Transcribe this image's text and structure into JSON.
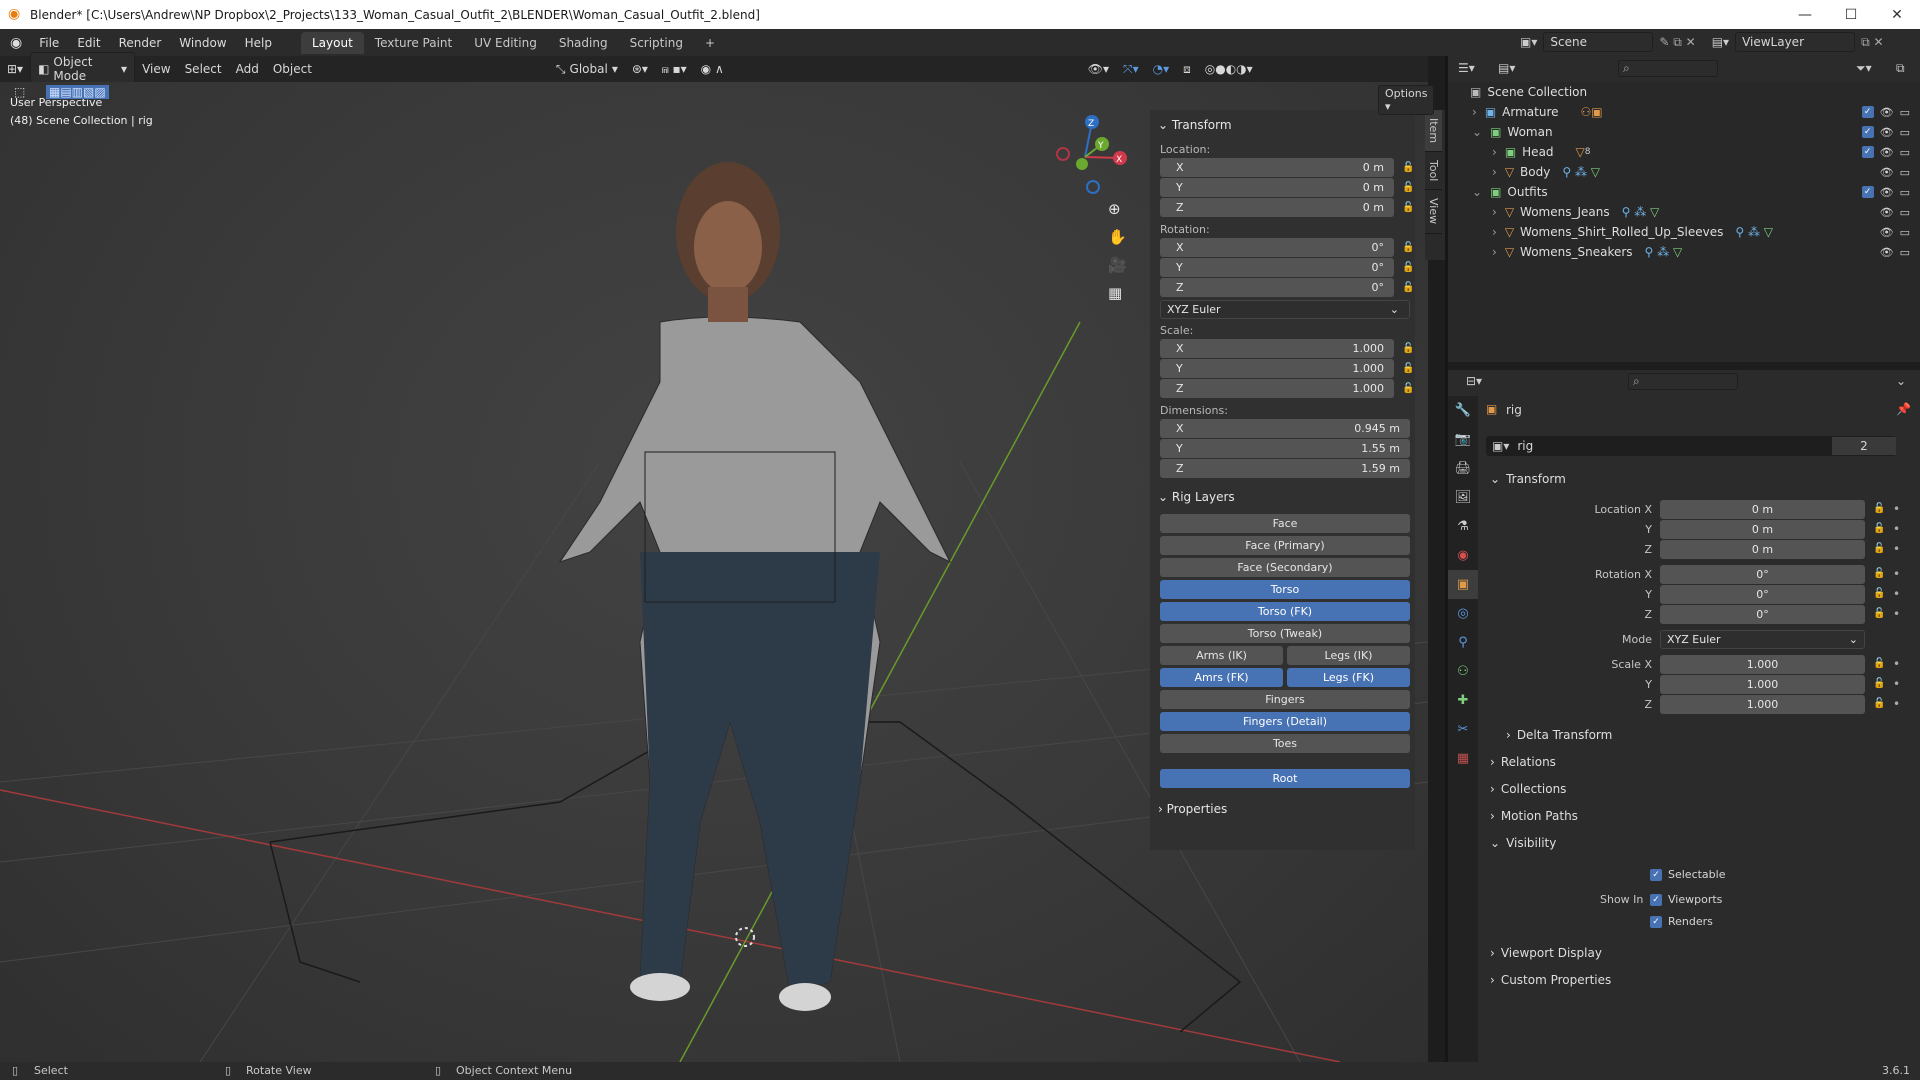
{
  "window": {
    "title": "Blender* [C:\\Users\\Andrew\\NP Dropbox\\2_Projects\\133_Woman_Casual_Outfit_2\\BLENDER\\Woman_Casual_Outfit_2.blend]"
  },
  "menu": {
    "items": [
      "File",
      "Edit",
      "Render",
      "Window",
      "Help"
    ]
  },
  "workspaces": [
    "Layout",
    "Texture Paint",
    "UV Editing",
    "Shading",
    "Scripting"
  ],
  "workspace_add": "+",
  "active_workspace": "Layout",
  "scene": {
    "label": "Scene",
    "viewlayer": "ViewLayer"
  },
  "viewport_header": {
    "mode": "Object Mode",
    "menus": [
      "View",
      "Select",
      "Add",
      "Object"
    ],
    "orientation": "Global",
    "options": "Options"
  },
  "viewport": {
    "perspective": "User Perspective",
    "collection": "(48) Scene Collection | rig"
  },
  "gizmo": {
    "x": "X",
    "y": "Y",
    "z": "Z"
  },
  "npanel": {
    "tabs": [
      "Item",
      "Tool",
      "View"
    ],
    "transform_title": "Transform",
    "location_label": "Location:",
    "location": [
      {
        "axis": "X",
        "value": "0 m"
      },
      {
        "axis": "Y",
        "value": "0 m"
      },
      {
        "axis": "Z",
        "value": "0 m"
      }
    ],
    "rotation_label": "Rotation:",
    "rotation": [
      {
        "axis": "X",
        "value": "0°"
      },
      {
        "axis": "Y",
        "value": "0°"
      },
      {
        "axis": "Z",
        "value": "0°"
      }
    ],
    "rotation_mode": "XYZ Euler",
    "scale_label": "Scale:",
    "scale": [
      {
        "axis": "X",
        "value": "1.000"
      },
      {
        "axis": "Y",
        "value": "1.000"
      },
      {
        "axis": "Z",
        "value": "1.000"
      }
    ],
    "dimensions_label": "Dimensions:",
    "dimensions": [
      {
        "axis": "X",
        "value": "0.945 m"
      },
      {
        "axis": "Y",
        "value": "1.55 m"
      },
      {
        "axis": "Z",
        "value": "1.59 m"
      }
    ],
    "rig_layers_title": "Rig Layers",
    "rig_layers": {
      "face": {
        "label": "Face",
        "on": false
      },
      "face_primary": {
        "label": "Face (Primary)",
        "on": false
      },
      "face_secondary": {
        "label": "Face (Secondary)",
        "on": false
      },
      "torso": {
        "label": "Torso",
        "on": true
      },
      "torso_fk": {
        "label": "Torso (FK)",
        "on": true
      },
      "torso_tweak": {
        "label": "Torso (Tweak)",
        "on": false
      },
      "arms_ik": {
        "label": "Arms (IK)",
        "on": false
      },
      "legs_ik": {
        "label": "Legs (IK)",
        "on": false
      },
      "arms_fk": {
        "label": "Amrs (FK)",
        "on": true
      },
      "legs_fk": {
        "label": "Legs (FK)",
        "on": true
      },
      "fingers": {
        "label": "Fingers",
        "on": false
      },
      "fingers_detail": {
        "label": "Fingers (Detail)",
        "on": true
      },
      "toes": {
        "label": "Toes",
        "on": false
      },
      "root": {
        "label": "Root",
        "on": true
      }
    },
    "properties_title": "Properties"
  },
  "outliner": {
    "root": "Scene Collection",
    "armature": "Armature",
    "woman": "Woman",
    "head": "Head",
    "head_badge": "8",
    "body": "Body",
    "outfits": "Outfits",
    "jeans": "Womens_Jeans",
    "shirt": "Womens_Shirt_Rolled_Up_Sleeves",
    "sneakers": "Womens_Sneakers"
  },
  "properties": {
    "object_name": "rig",
    "data_name": "rig",
    "users": "2",
    "transform_title": "Transform",
    "location_x_label": "Location X",
    "y_label": "Y",
    "z_label": "Z",
    "location": [
      "0 m",
      "0 m",
      "0 m"
    ],
    "rotation_x_label": "Rotation X",
    "rotation": [
      "0°",
      "0°",
      "0°"
    ],
    "mode_label": "Mode",
    "mode_value": "XYZ Euler",
    "scale_x_label": "Scale X",
    "scale": [
      "1.000",
      "1.000",
      "1.000"
    ],
    "delta_transform": "Delta Transform",
    "relations": "Relations",
    "collections": "Collections",
    "motion_paths": "Motion Paths",
    "visibility": "Visibility",
    "selectable": "Selectable",
    "show_in": "Show In",
    "viewports": "Viewports",
    "renders": "Renders",
    "viewport_display": "Viewport Display",
    "custom_properties": "Custom Properties"
  },
  "status": {
    "select": "Select",
    "rotate": "Rotate View",
    "context": "Object Context Menu",
    "version": "3.6.1"
  }
}
